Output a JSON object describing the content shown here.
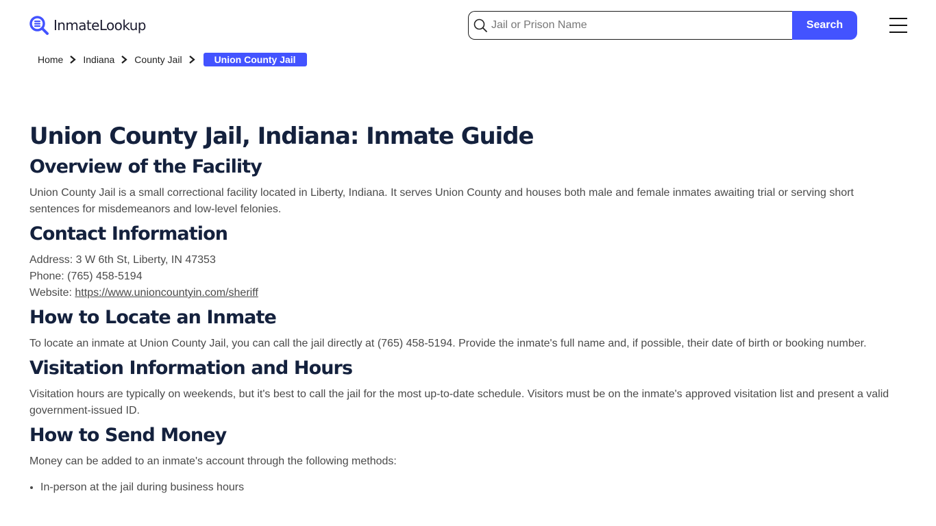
{
  "header": {
    "logo_text": "InmateLookup",
    "search": {
      "placeholder": "Jail or Prison Name",
      "value": "",
      "button_label": "Search"
    },
    "menu_icon": "hamburger-menu-icon"
  },
  "breadcrumb": {
    "items": [
      {
        "label": "Home"
      },
      {
        "label": "Indiana"
      },
      {
        "label": "County Jail"
      }
    ],
    "current": "Union County Jail"
  },
  "colors": {
    "accent": "#4353ff",
    "heading": "#14213d",
    "body_text": "#4a4a4a"
  },
  "article": {
    "title": "Union County Jail, Indiana: Inmate Guide",
    "sections": [
      {
        "heading": "Overview of the Facility",
        "text": "Union County Jail is a small correctional facility located in Liberty, Indiana. It serves Union County and houses both male and female inmates awaiting trial or serving short sentences for misdemeanors and low-level felonies."
      },
      {
        "heading": "Contact Information",
        "address_label": "Address:",
        "address": "3 W 6th St, Liberty, IN 47353",
        "phone_label": "Phone:",
        "phone": "(765) 458-5194",
        "website_label": "Website:",
        "website": "https://www.unioncountyin.com/sheriff"
      },
      {
        "heading": "How to Locate an Inmate",
        "text": "To locate an inmate at Union County Jail, you can call the jail directly at (765) 458-5194. Provide the inmate's full name and, if possible, their date of birth or booking number."
      },
      {
        "heading": "Visitation Information and Hours",
        "text": "Visitation hours are typically on weekends, but it's best to call the jail for the most up-to-date schedule. Visitors must be on the inmate's approved visitation list and present a valid government-issued ID."
      },
      {
        "heading": "How to Send Money",
        "text": "Money can be added to an inmate's account through the following methods:",
        "list": [
          "In-person at the jail during business hours"
        ]
      }
    ]
  }
}
